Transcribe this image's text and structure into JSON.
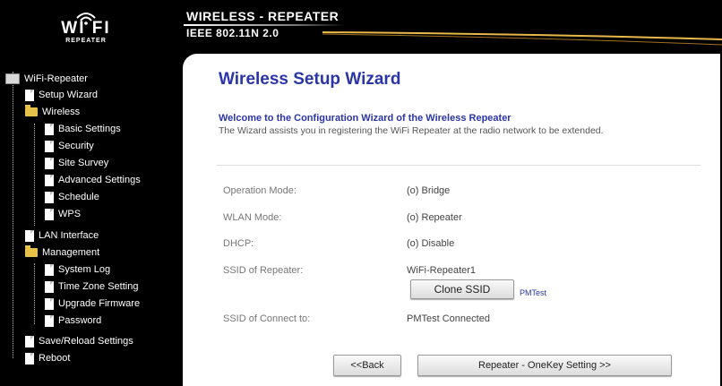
{
  "header": {
    "logo_text": "WI FI",
    "logo_sub": "REPEATER",
    "title": "WIRELESS - REPEATER",
    "subtitle": "IEEE 802.11N 2.0"
  },
  "sidebar": {
    "items": [
      {
        "label": "WiFi-Repeater",
        "icon": "root"
      },
      {
        "label": "Setup Wizard",
        "icon": "doc"
      },
      {
        "label": "Wireless",
        "icon": "folder"
      },
      {
        "label": "Basic Settings",
        "icon": "doc"
      },
      {
        "label": "Security",
        "icon": "doc"
      },
      {
        "label": "Site Survey",
        "icon": "doc"
      },
      {
        "label": "Advanced Settings",
        "icon": "doc"
      },
      {
        "label": "Schedule",
        "icon": "doc"
      },
      {
        "label": "WPS",
        "icon": "doc"
      },
      {
        "label": "LAN Interface",
        "icon": "doc"
      },
      {
        "label": "Management",
        "icon": "folder"
      },
      {
        "label": "System Log",
        "icon": "doc"
      },
      {
        "label": "Time Zone Setting",
        "icon": "doc"
      },
      {
        "label": "Upgrade Firmware",
        "icon": "doc"
      },
      {
        "label": "Password",
        "icon": "doc"
      },
      {
        "label": "Save/Reload Settings",
        "icon": "doc"
      },
      {
        "label": "Reboot",
        "icon": "doc"
      }
    ]
  },
  "main": {
    "title": "Wireless Setup Wizard",
    "welcome": "Welcome to the Configuration Wizard of the Wireless Repeater",
    "description": "The Wizard assists you in registering the WiFi Repeater at the radio network to be extended.",
    "fields": [
      {
        "label": "Operation Mode:",
        "value": "(o) Bridge"
      },
      {
        "label": "WLAN Mode:",
        "value": "(o) Repeater"
      },
      {
        "label": "DHCP:",
        "value": "(o) Disable"
      },
      {
        "label": "SSID of Repeater:",
        "value": "WiFi-Repeater1"
      },
      {
        "label": "SSID of Connect to:",
        "value": "PMTest  Connected"
      }
    ],
    "clone_ssid_label": "Clone SSID",
    "clone_ssid_hint": "PMTest",
    "back_label": "<<Back",
    "next_label": "Repeater - OneKey Setting >>"
  }
}
